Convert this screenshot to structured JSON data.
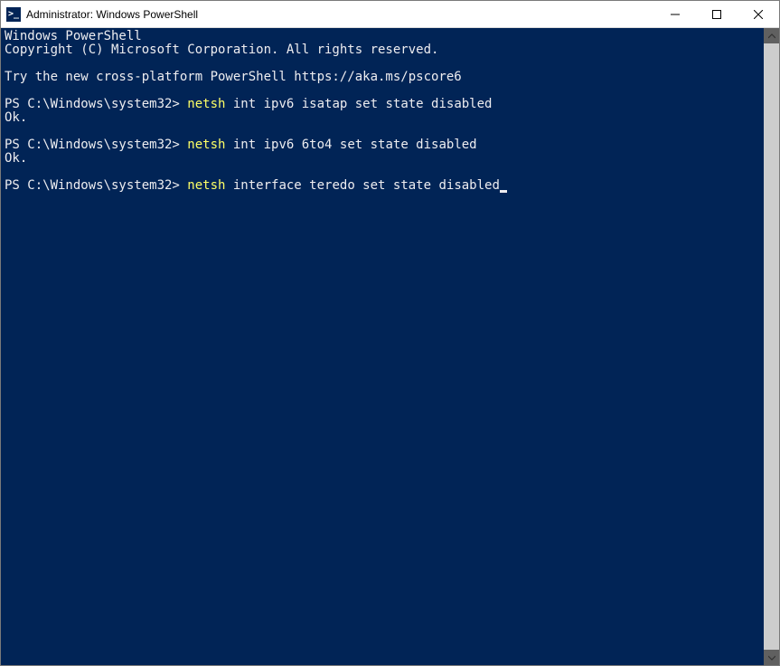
{
  "window": {
    "title": "Administrator: Windows PowerShell",
    "icon_glyph": ">_"
  },
  "terminal": {
    "header_line1": "Windows PowerShell",
    "header_line2": "Copyright (C) Microsoft Corporation. All rights reserved.",
    "try_line": "Try the new cross-platform PowerShell https://aka.ms/pscore6",
    "entries": [
      {
        "prompt": "PS C:\\Windows\\system32> ",
        "cmd_highlight": "netsh",
        "cmd_rest": " int ipv6 isatap set state disabled",
        "result": "Ok."
      },
      {
        "prompt": "PS C:\\Windows\\system32> ",
        "cmd_highlight": "netsh",
        "cmd_rest": " int ipv6 6to4 set state disabled",
        "result": "Ok."
      },
      {
        "prompt": "PS C:\\Windows\\system32> ",
        "cmd_highlight": "netsh",
        "cmd_rest": " interface teredo set state disabled",
        "result": ""
      }
    ]
  }
}
